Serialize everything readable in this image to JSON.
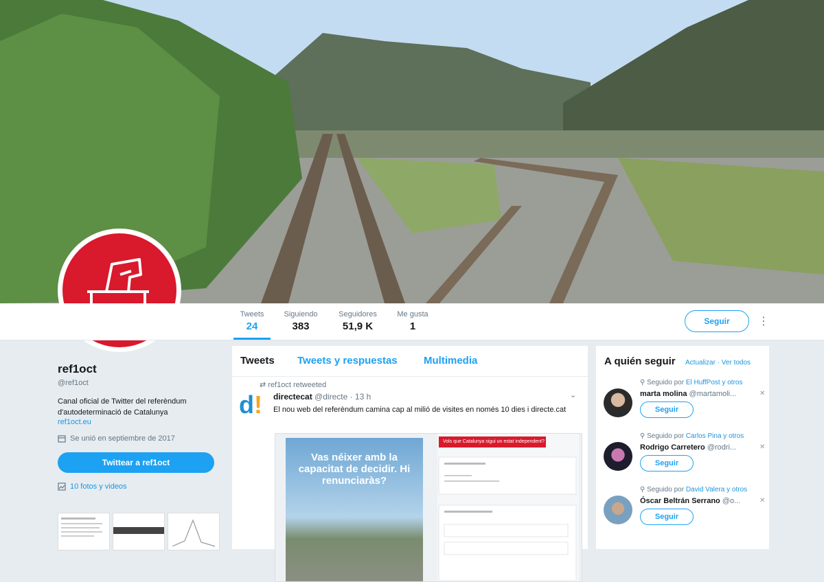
{
  "profile": {
    "name": "ref1oct",
    "handle": "@ref1oct",
    "bio": "Canal oficial de Twitter del referèndum d'autodeterminació de Catalunya",
    "link": "ref1oct.eu",
    "joined": "Se unió en septiembre de 2017",
    "tweet_to_label": "Twittear a ref1oct",
    "photos_label": "10 fotos y videos"
  },
  "stats": [
    {
      "label": "Tweets",
      "value": "24"
    },
    {
      "label": "Siguiendo",
      "value": "383"
    },
    {
      "label": "Seguidores",
      "value": "51,9 K"
    },
    {
      "label": "Me gusta",
      "value": "1"
    }
  ],
  "header": {
    "follow_label": "Seguir",
    "more_icon": "vertical-dots-icon"
  },
  "timeline": {
    "tabs": [
      "Tweets",
      "Tweets y respuestas",
      "Multimedia"
    ],
    "retweet_line": "ref1oct retweeted",
    "tweet": {
      "author": "directecat",
      "handle": "@directe",
      "time": "· 13 h",
      "text": "El nou web del referèndum camina cap al milió de visites en només 10 dies i directe.cat",
      "media_question": "Vas néixer amb la capacitat de decidir. Hi renunciaràs?",
      "media_red_label": "Vols que Catalunya sigui un estat independent?"
    }
  },
  "who_to_follow": {
    "title": "A quién seguir",
    "refresh": "Actualizar",
    "view_all": "Ver todos",
    "items": [
      {
        "followed_by": "Seguido por",
        "followed_by_names": "El HuffPost y otros",
        "name": "marta molina",
        "handle": "@martamoli...",
        "button": "Seguir"
      },
      {
        "followed_by": "Seguido por",
        "followed_by_names": "Carlos Pina y otros",
        "name": "Rodrigo Carretero",
        "handle": "@rodri...",
        "button": "Seguir"
      },
      {
        "followed_by": "Seguido por",
        "followed_by_names": "David Valera y otros",
        "name": "Óscar Beltrán Serrano",
        "handle": "@o...",
        "button": "Seguir"
      }
    ]
  },
  "colors": {
    "brand_red": "#d9192c",
    "twitter_blue": "#1da1f2"
  }
}
